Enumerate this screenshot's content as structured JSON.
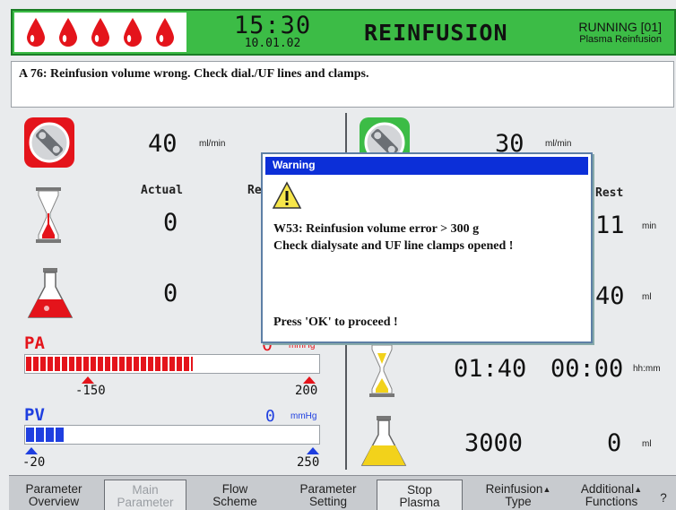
{
  "header": {
    "time": "15:30",
    "date": "10.01.02",
    "mode": "REINFUSION",
    "status_main": "RUNNING [01]",
    "status_sub": "Plasma Reinfusion",
    "blood_drop_count": 5
  },
  "alarm": {
    "message": "A 76: Reinfusion volume wrong. Check dial./UF lines and clamps."
  },
  "left_panel": {
    "pump_rate": "40",
    "pump_unit": "ml/min",
    "col_actual": "Actual",
    "col_rest_partial": "Re",
    "time_actual": "0",
    "volume_actual": "0"
  },
  "pa": {
    "label": "PA",
    "value": "0",
    "unit": "mmHg",
    "min": "-150",
    "max": "200",
    "fill_fraction": 0.57
  },
  "pv": {
    "label": "PV",
    "value": "0",
    "unit": "mmHg",
    "min": "-20",
    "max": "250",
    "fill_fraction": 0.13
  },
  "right_panel": {
    "pump_rate": "30",
    "pump_unit": "ml/min",
    "col_rest": "Rest",
    "rest_time": "11",
    "rest_time_unit": "min",
    "rest_volume": "40",
    "rest_volume_unit": "ml",
    "timer_actual": "01:40",
    "timer_rest": "00:00",
    "timer_unit": "hh:mm",
    "vol_actual": "3000",
    "vol_rest": "0",
    "vol_unit": "ml"
  },
  "dialog": {
    "title": "Warning",
    "line1": "W53: Reinfusion volume error > 300 g",
    "line2": "Check dialysate and UF line clamps opened !",
    "prompt": "Press 'OK' to proceed !"
  },
  "bottom_bar": {
    "btn1_l1": "Parameter",
    "btn1_l2": "Overview",
    "btn2_l1": "Main",
    "btn2_l2": "Parameter",
    "btn3_l1": "Flow",
    "btn3_l2": "Scheme",
    "btn4_l1": "Parameter",
    "btn4_l2": "Setting",
    "btn5_l1": "Stop",
    "btn5_l2": "Plasma",
    "btn6_l1": "Reinfusion",
    "btn6_l2": "Type",
    "btn7_l1": "Additional",
    "btn7_l2": "Functions",
    "help": "?",
    "caret": "▲"
  },
  "colors": {
    "header_green": "#3cbc46",
    "alarm_red": "#e4141b",
    "pv_blue": "#1f3fe0",
    "dialog_title_blue": "#0c2fd8",
    "flask_yellow": "#f2d21b"
  }
}
